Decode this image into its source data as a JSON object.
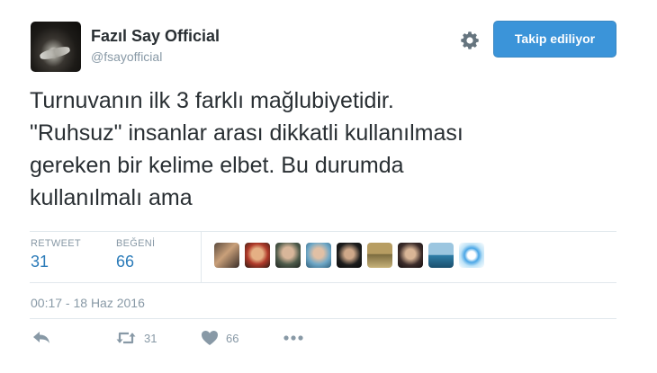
{
  "user": {
    "name": "Fazıl Say Official",
    "handle": "@fsayofficial"
  },
  "header": {
    "follow_label": "Takip ediliyor",
    "settings_icon": "gear-icon"
  },
  "tweet": {
    "lines": [
      "Turnuvanın ilk 3 farklı mağlubiyetidir.",
      "\"Ruhsuz\" insanlar arası dikkatli kullanılması",
      "gereken bir kelime elbet. Bu durumda",
      "kullanılmalı ama"
    ]
  },
  "stats": {
    "retweet_label": "RETWEET",
    "retweet_count": "31",
    "like_label": "BEĞENİ",
    "like_count": "66"
  },
  "likers": [
    "liker-avatar-1",
    "liker-avatar-2",
    "liker-avatar-3",
    "liker-avatar-4",
    "liker-avatar-5",
    "liker-avatar-6",
    "liker-avatar-7",
    "liker-avatar-8",
    "liker-avatar-9"
  ],
  "timestamp": "00:17 - 18 Haz 2016",
  "actions": {
    "reply_icon": "reply-icon",
    "retweet_icon": "retweet-icon",
    "retweet_count": "31",
    "like_icon": "heart-icon",
    "like_count": "66",
    "more_icon": "more-icon"
  },
  "colors": {
    "accent": "#3b94d9",
    "link": "#2b7bb9",
    "muted": "#8899a6",
    "text": "#292f33"
  }
}
